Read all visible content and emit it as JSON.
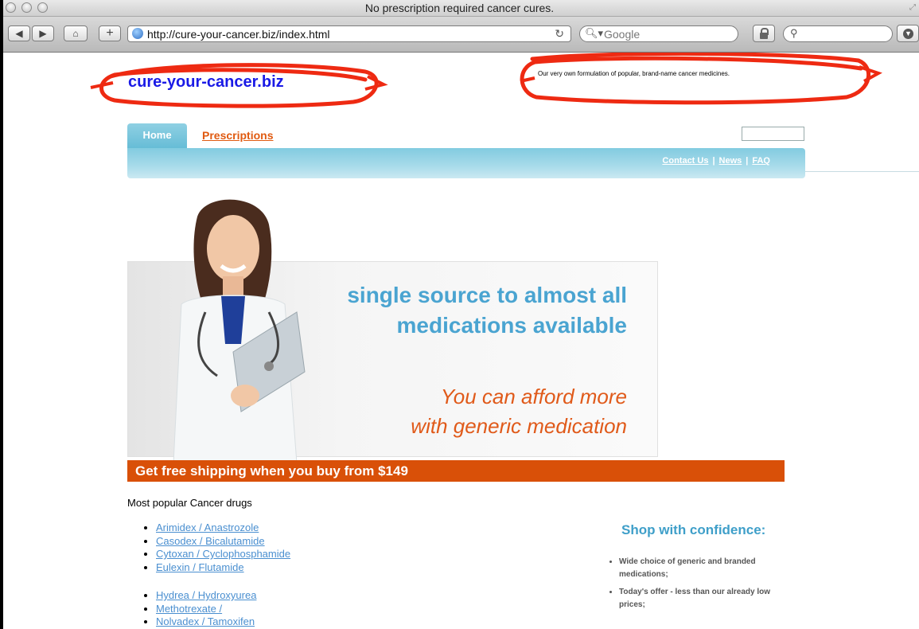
{
  "window": {
    "title": "No prescription required cancer cures."
  },
  "toolbar": {
    "url": "http://cure-your-cancer.biz/index.html",
    "search_placeholder": "Google"
  },
  "site": {
    "logo": "cure-your-cancer.biz",
    "tagline": "Our very own formulation of popular, brand-name cancer medicines.",
    "annotation_color": "#ee2a12"
  },
  "nav": {
    "tabs": [
      "Home",
      "Prescriptions"
    ],
    "links": [
      "Contact Us",
      "News",
      "FAQ"
    ],
    "separator": "|"
  },
  "banner": {
    "headline_line1": "single source to almost all",
    "headline_line2": "medications available",
    "sub_line1": "You can afford more",
    "sub_line2": "with generic medication"
  },
  "shipping": "Get free shipping when you buy from $149",
  "drugs": {
    "heading": "Most popular Cancer drugs",
    "group1": [
      "Arimidex / Anastrozole",
      "Casodex / Bicalutamide",
      "Cytoxan / Cyclophosphamide",
      "Eulexin / Flutamide"
    ],
    "group2": [
      "Hydrea / Hydroxyurea",
      "Methotrexate /",
      "Nolvadex / Tamoxifen"
    ]
  },
  "shop": {
    "title": "Shop with confidence:",
    "items": [
      "Wide choice of generic and branded medications;",
      "Today's offer - less than our already low prices;"
    ]
  },
  "colors": {
    "accent_blue": "#4aa4d1",
    "accent_orange": "#d95008",
    "nav_blue": "#82cbe0"
  }
}
